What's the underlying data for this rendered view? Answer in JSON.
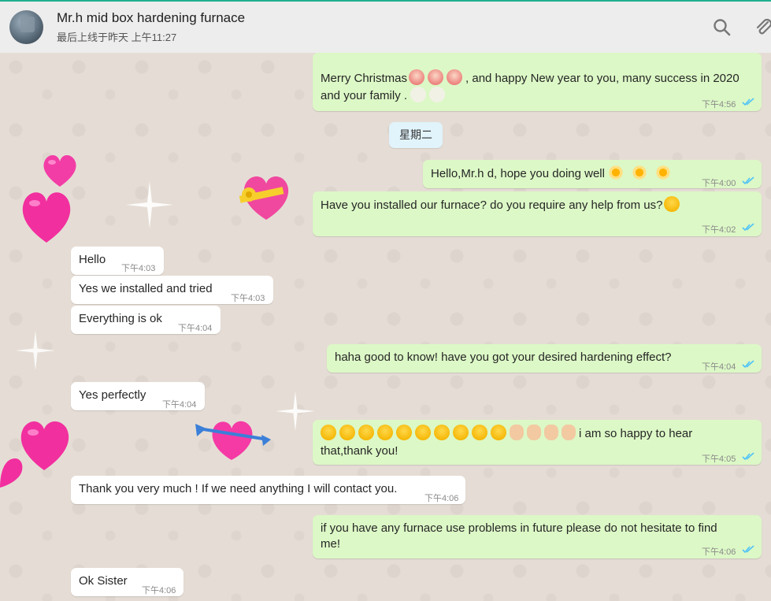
{
  "header": {
    "contact_name": "Mr.h     mid box hardening furnace",
    "last_seen": "最后上线于昨天 上午11:27",
    "search_icon": "search-icon",
    "attach_icon": "paperclip-icon"
  },
  "date_divider": "星期二",
  "messages": [
    {
      "dir": "out",
      "text_lines": [
        "Merry Christmas",
        ", and happy New year to you, many success in 2020",
        "and your family ."
      ],
      "time": "下午4:56",
      "ticks": "read"
    },
    {
      "dir": "out",
      "text": "Hello,Mr.h      d, hope you doing well",
      "time": "下午4:00",
      "ticks": "read"
    },
    {
      "dir": "out",
      "text": "Have you installed our furnace? do you require any help from us?",
      "time": "下午4:02",
      "ticks": "read"
    },
    {
      "dir": "in",
      "text": "Hello",
      "time": "下午4:03"
    },
    {
      "dir": "in",
      "text": "Yes we installed and tried",
      "time": "下午4:03"
    },
    {
      "dir": "in",
      "text": "Everything is ok",
      "time": "下午4:04"
    },
    {
      "dir": "out",
      "text": "haha good to know! have you got your desired hardening effect?",
      "time": "下午4:04",
      "ticks": "read"
    },
    {
      "dir": "in",
      "text": "Yes perfectly",
      "time": "下午4:04"
    },
    {
      "dir": "out",
      "text_lines": [
        "i am so happy to hear",
        "that,thank you!"
      ],
      "time": "下午4:05",
      "ticks": "read"
    },
    {
      "dir": "in",
      "text": "Thank you very much ! If we need anything I will contact you.",
      "time": "下午4:06"
    },
    {
      "dir": "out",
      "text_lines": [
        "if you have any furnace use problems in future please do not hesitate to find",
        "me!"
      ],
      "time": "下午4:06",
      "ticks": "read"
    },
    {
      "dir": "in",
      "text": "Ok Sister",
      "time": "下午4:06"
    }
  ],
  "colors": {
    "outgoing": "#dcf8c6",
    "incoming": "#ffffff",
    "read_ticks": "#4fc3f7",
    "header_bg": "#ededed",
    "accent": "#1faf8f"
  },
  "stickers": [
    "heart-sticker",
    "gift-heart-sticker",
    "arrow-heart-sticker",
    "sparkle-sticker"
  ]
}
